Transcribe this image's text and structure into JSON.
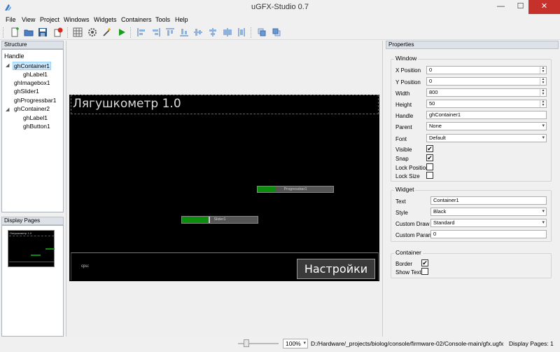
{
  "window": {
    "title": "uGFX-Studio 0.7",
    "minimize": "—",
    "maximize": "☐",
    "close": "✕"
  },
  "menu": [
    "File",
    "View",
    "Project",
    "Windows",
    "Widgets",
    "Containers",
    "Tools",
    "Help"
  ],
  "toolbar": {
    "icons": [
      "new-file-icon",
      "open-folder-icon",
      "save-icon",
      "close-project-icon",
      "grid-icon",
      "settings-gear-icon",
      "wand-icon",
      "run-icon",
      "align-left-icon",
      "align-right-icon",
      "align-top-icon",
      "align-bottom-icon",
      "center-horizontal-icon",
      "center-vertical-icon",
      "distribute-icon",
      "bring-front-icon",
      "send-back-icon"
    ]
  },
  "structure": {
    "title": "Structure",
    "header": "Handle",
    "items": [
      {
        "label": "ghContainer1",
        "level": 0,
        "expanded": true,
        "selected": true
      },
      {
        "label": "ghLabel1",
        "level": 1
      },
      {
        "label": "ghImagebox1",
        "level": 0
      },
      {
        "label": "ghSlider1",
        "level": 0
      },
      {
        "label": "ghProgressbar1",
        "level": 0
      },
      {
        "label": "ghContainer2",
        "level": 0,
        "expanded": true
      },
      {
        "label": "ghLabel1",
        "level": 1
      },
      {
        "label": "ghButton1",
        "level": 1
      }
    ]
  },
  "display_pages": {
    "title": "Display Pages"
  },
  "canvas": {
    "container1_label": "Лягушкометр 1.0",
    "progressbar_label": "Progressbar1",
    "progressbar_value": 0.24,
    "slider_label": "Slider1",
    "slider_value": 0.35,
    "cpu_label": "cpu:",
    "settings_button": "Настройки",
    "thumb_title": "Лягушкометр 1.0"
  },
  "properties": {
    "title": "Properties",
    "window_group": {
      "title": "Window",
      "x_label": "X Position",
      "x_value": "0",
      "y_label": "Y Position",
      "y_value": "0",
      "width_label": "Width",
      "width_value": "800",
      "height_label": "Height",
      "height_value": "50",
      "handle_label": "Handle",
      "handle_value": "ghContainer1",
      "parent_label": "Parent",
      "parent_value": "None",
      "font_label": "Font",
      "font_value": "Default",
      "visible_label": "Visible",
      "visible": true,
      "snap_label": "Snap",
      "snap": true,
      "lock_position_label": "Lock Position",
      "lock_position": false,
      "lock_size_label": "Lock Size",
      "lock_size": false
    },
    "widget_group": {
      "title": "Widget",
      "text_label": "Text",
      "text_value": "Container1",
      "style_label": "Style",
      "style_value": "Black",
      "custom_draw_label": "Custom Draw",
      "custom_draw_value": "Standard",
      "custom_param_label": "Custom Param",
      "custom_param_value": "0"
    },
    "container_group": {
      "title": "Container",
      "border_label": "Border",
      "border": true,
      "show_text_label": "Show Text",
      "show_text": false
    }
  },
  "statusbar": {
    "zoom_value": "100%",
    "path": "D:/Hardware/_projects/biolog/console/firmware-02/Console-main/gfx.ugfx",
    "pages": "Display Pages: 1"
  },
  "colors": {
    "selection": "#cce8ff",
    "close_button": "#c7312c",
    "widget_green": "#0c8c0c",
    "screen": "#000000"
  }
}
